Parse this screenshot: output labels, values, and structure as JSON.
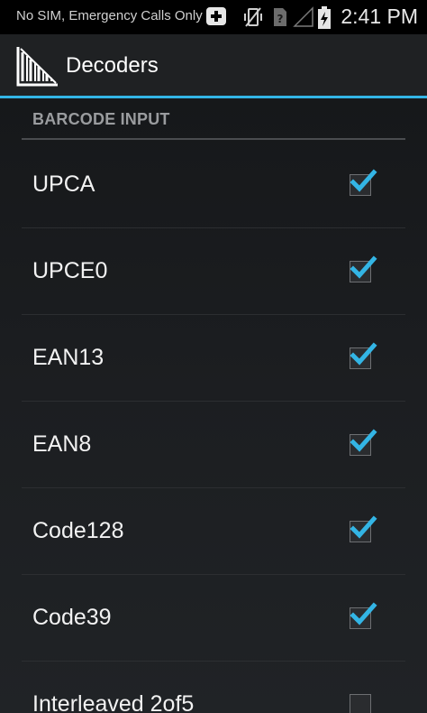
{
  "status_bar": {
    "carrier": "No SIM, Emergency Calls Only",
    "time": "2:41 PM",
    "icons": [
      "add-notification-icon",
      "vibrate-icon",
      "no-sim-icon",
      "signal-icon",
      "battery-charging-icon"
    ]
  },
  "action_bar": {
    "title": "Decoders",
    "icon": "barcode-app-icon"
  },
  "colors": {
    "accent": "#33b5e5",
    "background": "#1b1d20",
    "divider": "#4a4c4f"
  },
  "section": {
    "header": "BARCODE INPUT"
  },
  "decoders": [
    {
      "label": "UPCA",
      "checked": true
    },
    {
      "label": "UPCE0",
      "checked": true
    },
    {
      "label": "EAN13",
      "checked": true
    },
    {
      "label": "EAN8",
      "checked": true
    },
    {
      "label": "Code128",
      "checked": true
    },
    {
      "label": "Code39",
      "checked": true
    },
    {
      "label": "Interleaved 2of5",
      "checked": false
    }
  ]
}
